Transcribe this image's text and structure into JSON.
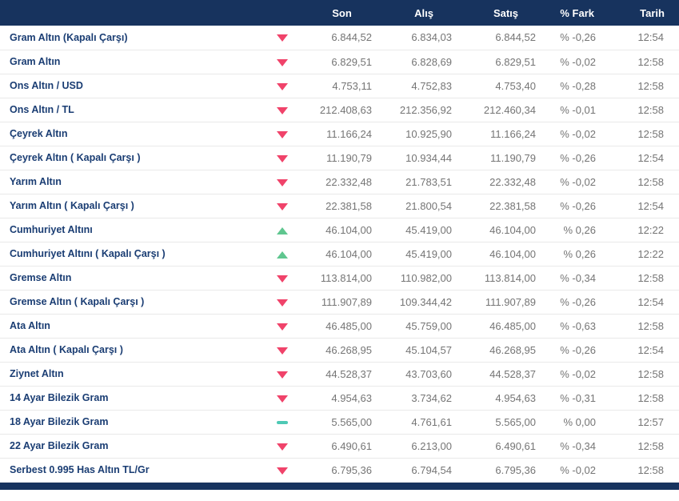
{
  "colors": {
    "header-bg": "#17335e",
    "row-name": "#1a3d73",
    "value-text": "#757575",
    "down": "#f0436a",
    "up": "#5fc68f",
    "flat": "#4ec9b5",
    "row-border": "#e9e9e9"
  },
  "table": {
    "columns": [
      "Son",
      "Alış",
      "Satış",
      "% Fark",
      "Tarih"
    ],
    "rows": [
      {
        "name": "Gram Altın (Kapalı Çarşı)",
        "direction": "down",
        "son": "6.844,52",
        "alis": "6.834,03",
        "satis": "6.844,52",
        "fark": "% -0,26",
        "tarih": "12:54"
      },
      {
        "name": "Gram Altın",
        "direction": "down",
        "son": "6.829,51",
        "alis": "6.828,69",
        "satis": "6.829,51",
        "fark": "% -0,02",
        "tarih": "12:58"
      },
      {
        "name": "Ons Altın / USD",
        "direction": "down",
        "son": "4.753,11",
        "alis": "4.752,83",
        "satis": "4.753,40",
        "fark": "% -0,28",
        "tarih": "12:58"
      },
      {
        "name": "Ons Altın / TL",
        "direction": "down",
        "son": "212.408,63",
        "alis": "212.356,92",
        "satis": "212.460,34",
        "fark": "% -0,01",
        "tarih": "12:58"
      },
      {
        "name": "Çeyrek Altın",
        "direction": "down",
        "son": "11.166,24",
        "alis": "10.925,90",
        "satis": "11.166,24",
        "fark": "% -0,02",
        "tarih": "12:58"
      },
      {
        "name": "Çeyrek Altın ( Kapalı Çarşı )",
        "direction": "down",
        "son": "11.190,79",
        "alis": "10.934,44",
        "satis": "11.190,79",
        "fark": "% -0,26",
        "tarih": "12:54"
      },
      {
        "name": "Yarım Altın",
        "direction": "down",
        "son": "22.332,48",
        "alis": "21.783,51",
        "satis": "22.332,48",
        "fark": "% -0,02",
        "tarih": "12:58"
      },
      {
        "name": "Yarım Altın ( Kapalı Çarşı )",
        "direction": "down",
        "son": "22.381,58",
        "alis": "21.800,54",
        "satis": "22.381,58",
        "fark": "% -0,26",
        "tarih": "12:54"
      },
      {
        "name": "Cumhuriyet Altını",
        "direction": "up",
        "son": "46.104,00",
        "alis": "45.419,00",
        "satis": "46.104,00",
        "fark": "% 0,26",
        "tarih": "12:22"
      },
      {
        "name": "Cumhuriyet Altını ( Kapalı Çarşı )",
        "direction": "up",
        "son": "46.104,00",
        "alis": "45.419,00",
        "satis": "46.104,00",
        "fark": "% 0,26",
        "tarih": "12:22"
      },
      {
        "name": "Gremse Altın",
        "direction": "down",
        "son": "113.814,00",
        "alis": "110.982,00",
        "satis": "113.814,00",
        "fark": "% -0,34",
        "tarih": "12:58"
      },
      {
        "name": "Gremse Altın ( Kapalı Çarşı )",
        "direction": "down",
        "son": "111.907,89",
        "alis": "109.344,42",
        "satis": "111.907,89",
        "fark": "% -0,26",
        "tarih": "12:54"
      },
      {
        "name": "Ata Altın",
        "direction": "down",
        "son": "46.485,00",
        "alis": "45.759,00",
        "satis": "46.485,00",
        "fark": "% -0,63",
        "tarih": "12:58"
      },
      {
        "name": "Ata Altın ( Kapalı Çarşı )",
        "direction": "down",
        "son": "46.268,95",
        "alis": "45.104,57",
        "satis": "46.268,95",
        "fark": "% -0,26",
        "tarih": "12:54"
      },
      {
        "name": "Ziynet Altın",
        "direction": "down",
        "son": "44.528,37",
        "alis": "43.703,60",
        "satis": "44.528,37",
        "fark": "% -0,02",
        "tarih": "12:58"
      },
      {
        "name": "14 Ayar Bilezik Gram",
        "direction": "down",
        "son": "4.954,63",
        "alis": "3.734,62",
        "satis": "4.954,63",
        "fark": "% -0,31",
        "tarih": "12:58"
      },
      {
        "name": "18 Ayar Bilezik Gram",
        "direction": "flat",
        "son": "5.565,00",
        "alis": "4.761,61",
        "satis": "5.565,00",
        "fark": "% 0,00",
        "tarih": "12:57"
      },
      {
        "name": "22 Ayar Bilezik Gram",
        "direction": "down",
        "son": "6.490,61",
        "alis": "6.213,00",
        "satis": "6.490,61",
        "fark": "% -0,34",
        "tarih": "12:58"
      },
      {
        "name": "Serbest 0.995 Has Altın TL/Gr",
        "direction": "down",
        "son": "6.795,36",
        "alis": "6.794,54",
        "satis": "6.795,36",
        "fark": "% -0,02",
        "tarih": "12:58"
      }
    ]
  }
}
